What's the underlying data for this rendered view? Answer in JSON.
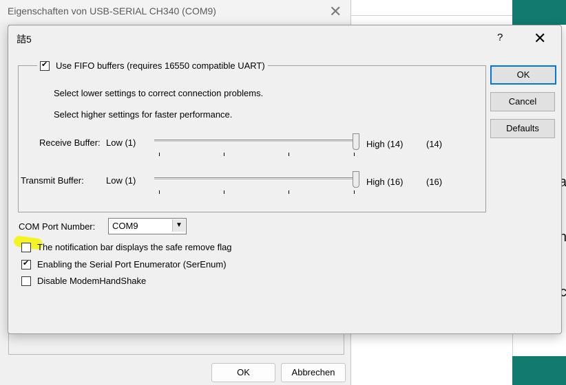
{
  "parent_window": {
    "title": "Eigenschaften von USB-SERIAL CH340 (COM9)",
    "ok_label": "OK",
    "cancel_label": "Abbrechen"
  },
  "dialog": {
    "title": "詰5",
    "help_label": "?",
    "fifo": {
      "label": "Use FIFO buffers (requires 16550 compatible UART)",
      "checked": true
    },
    "hint_lower": "Select lower settings to correct connection problems.",
    "hint_higher": "Select higher settings for faster performance.",
    "receive": {
      "label": "Receive Buffer:",
      "low": "Low (1)",
      "high": "High (14)",
      "value": "(14)",
      "level": 1.0
    },
    "transmit": {
      "label": "Transmit Buffer:",
      "low": "Low (1)",
      "high": "High (16)",
      "value": "(16)",
      "level": 1.0
    },
    "com_port": {
      "label": "COM Port Number:",
      "value": "COM9"
    },
    "options": [
      {
        "label": "The notification bar displays the safe remove flag",
        "checked": false
      },
      {
        "label": "Enabling the Serial Port Enumerator (SerEnum)",
        "checked": true
      },
      {
        "label": "Disable ModemHandShake",
        "checked": false
      }
    ],
    "buttons": {
      "ok": "OK",
      "cancel": "Cancel",
      "defaults": "Defaults"
    }
  },
  "colors": {
    "accent": "#0078d7",
    "highlight": "#f5f500",
    "teal": "#127a6e"
  }
}
